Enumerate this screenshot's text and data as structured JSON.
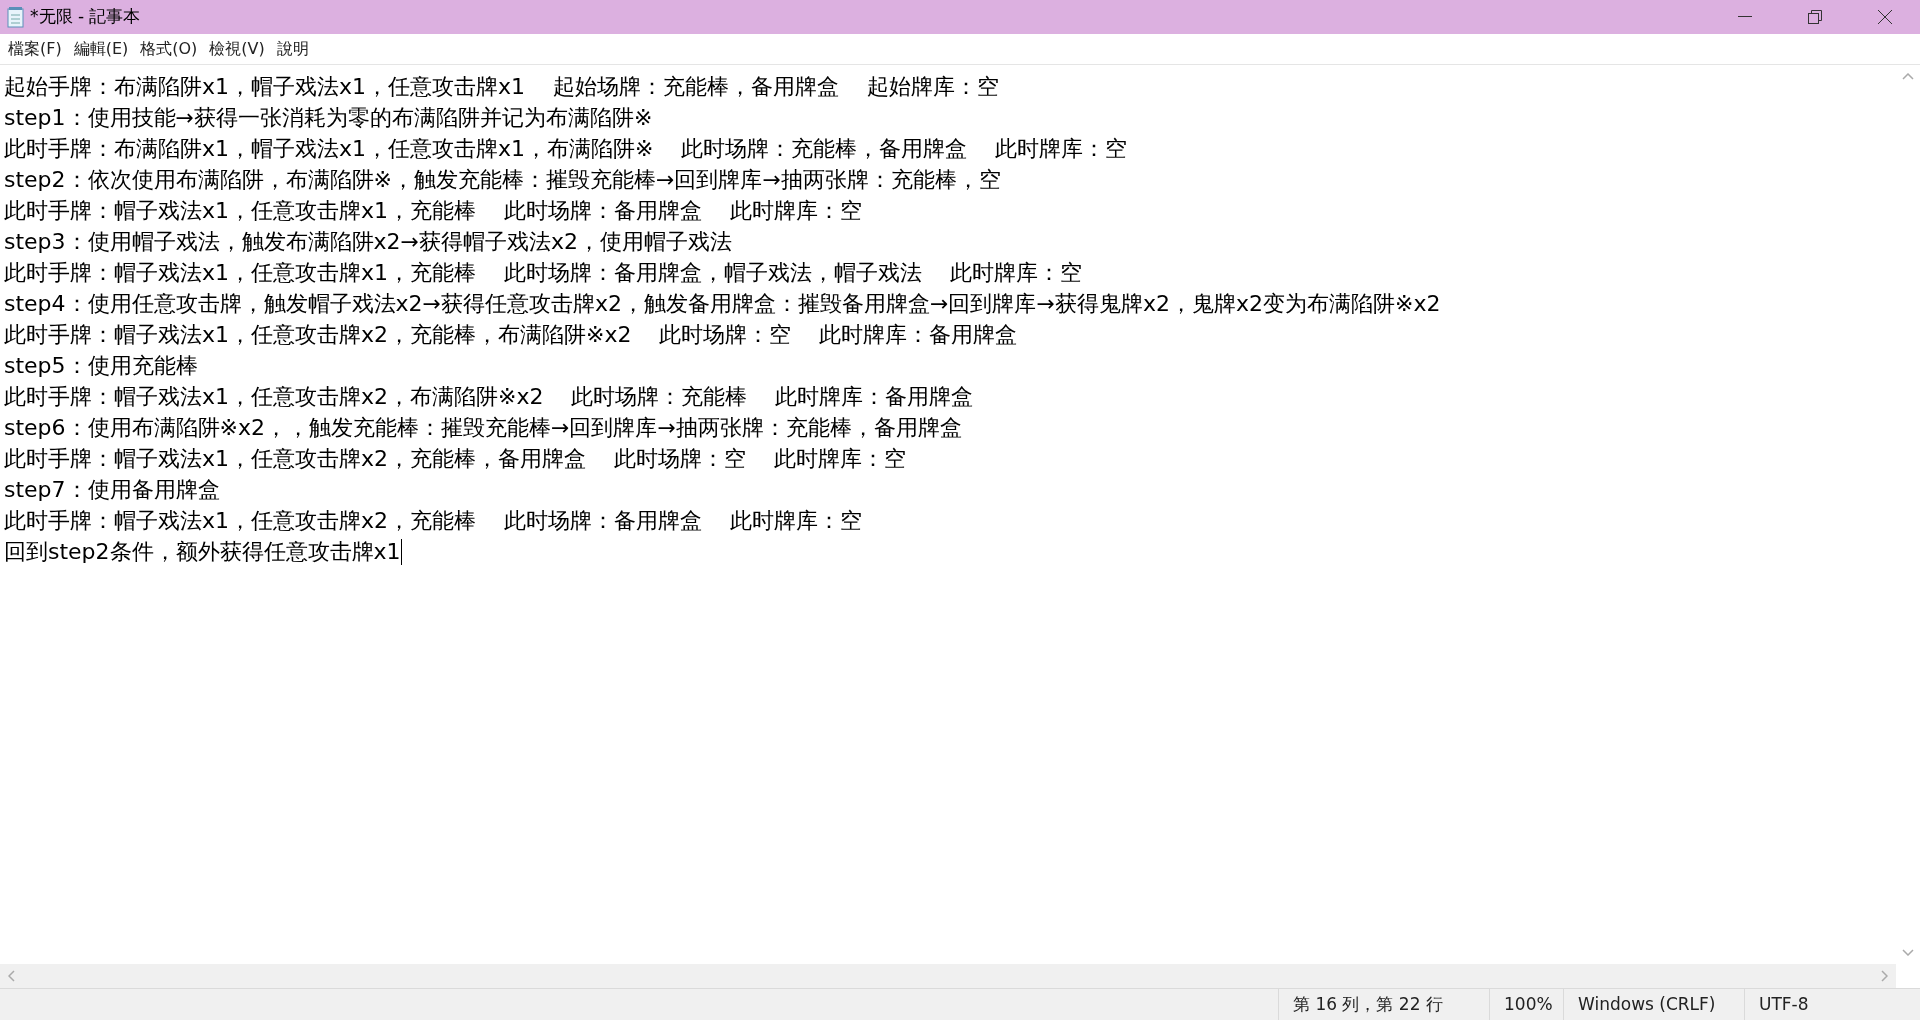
{
  "window": {
    "title": "*无限 - 記事本"
  },
  "menu": [
    "檔案(F)",
    "編輯(E)",
    "格式(O)",
    "檢視(V)",
    "說明"
  ],
  "editor": {
    "lines": [
      "起始手牌：布满陷阱x1，帽子戏法x1，任意攻击牌x1    起始场牌：充能棒，备用牌盒    起始牌库：空",
      "step1：使用技能→获得一张消耗为零的布满陷阱并记为布满陷阱※",
      "此时手牌：布满陷阱x1，帽子戏法x1，任意攻击牌x1，布满陷阱※    此时场牌：充能棒，备用牌盒    此时牌库：空",
      "step2：依次使用布满陷阱，布满陷阱※，触发充能棒：摧毁充能棒→回到牌库→抽两张牌：充能棒，空",
      "此时手牌：帽子戏法x1，任意攻击牌x1，充能棒    此时场牌：备用牌盒    此时牌库：空",
      "step3：使用帽子戏法，触发布满陷阱x2→获得帽子戏法x2，使用帽子戏法",
      "此时手牌：帽子戏法x1，任意攻击牌x1，充能棒    此时场牌：备用牌盒，帽子戏法，帽子戏法    此时牌库：空",
      "step4：使用任意攻击牌，触发帽子戏法x2→获得任意攻击牌x2，触发备用牌盒：摧毁备用牌盒→回到牌库→获得鬼牌x2，鬼牌x2变为布满陷阱※x2",
      "此时手牌：帽子戏法x1，任意攻击牌x2，充能棒，布满陷阱※x2    此时场牌：空    此时牌库：备用牌盒",
      "step5：使用充能棒",
      "此时手牌：帽子戏法x1，任意攻击牌x2，布满陷阱※x2    此时场牌：充能棒    此时牌库：备用牌盒",
      "step6：使用布满陷阱※x2，，触发充能棒：摧毁充能棒→回到牌库→抽两张牌：充能棒，备用牌盒",
      "此时手牌：帽子戏法x1，任意攻击牌x2，充能棒，备用牌盒    此时场牌：空    此时牌库：空",
      "step7：使用备用牌盒",
      "此时手牌：帽子戏法x1，任意攻击牌x2，充能棒    此时场牌：备用牌盒    此时牌库：空",
      "回到step2条件，额外获得任意攻击牌x1"
    ]
  },
  "status_bar": [
    "第 16 列，第 22 行",
    "100%",
    "Windows (CRLF)",
    "UTF-8"
  ]
}
